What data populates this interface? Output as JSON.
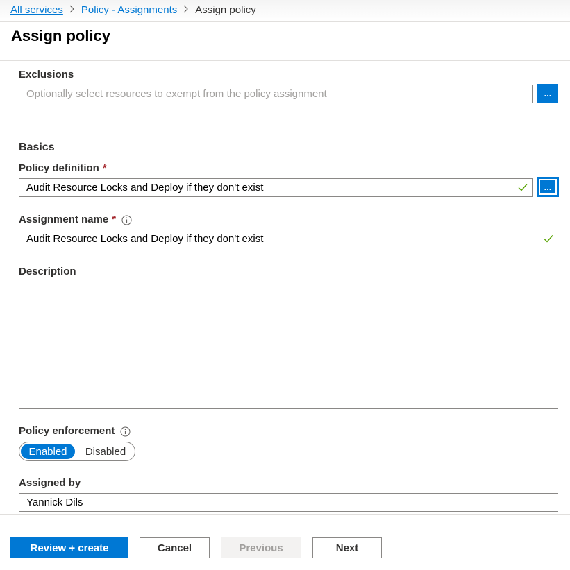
{
  "breadcrumb": {
    "items": [
      {
        "label": "All services"
      },
      {
        "label": "Policy - Assignments"
      },
      {
        "label": "Assign policy"
      }
    ]
  },
  "page": {
    "title": "Assign policy"
  },
  "form": {
    "exclusions": {
      "label": "Exclusions",
      "placeholder": "Optionally select resources to exempt from the policy assignment",
      "browse_label": "..."
    },
    "basics_title": "Basics",
    "policy_definition": {
      "label": "Policy definition",
      "required_mark": "*",
      "value": "Audit Resource Locks and Deploy if they don't exist",
      "browse_label": "..."
    },
    "assignment_name": {
      "label": "Assignment name",
      "required_mark": "*",
      "value": "Audit Resource Locks and Deploy if they don't exist"
    },
    "description": {
      "label": "Description",
      "value": ""
    },
    "policy_enforcement": {
      "label": "Policy enforcement",
      "options": [
        "Enabled",
        "Disabled"
      ],
      "selected": "Enabled"
    },
    "assigned_by": {
      "label": "Assigned by",
      "value": "Yannick Dils"
    }
  },
  "footer": {
    "review_create": "Review + create",
    "cancel": "Cancel",
    "previous": "Previous",
    "next": "Next"
  },
  "colors": {
    "accent": "#0078d4",
    "required": "#a4262c",
    "valid_check": "#57a300"
  }
}
